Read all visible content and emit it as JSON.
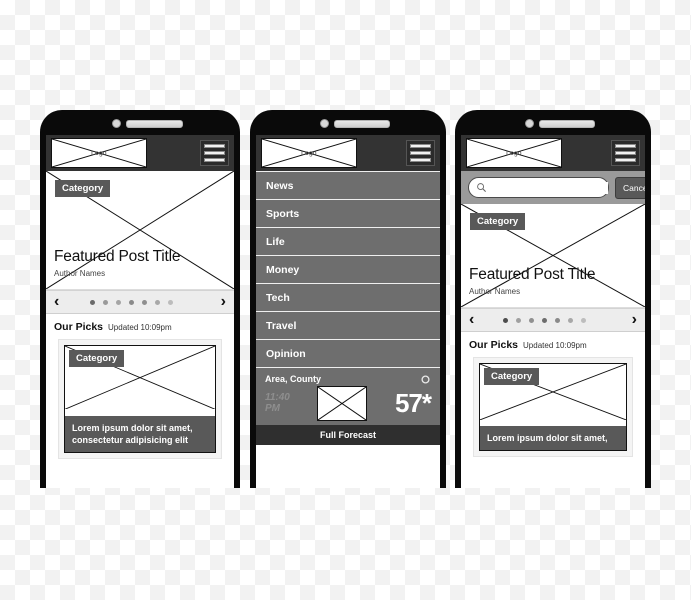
{
  "brand": {
    "logo_label": "Logo",
    "menu_icon": "hamburger-icon",
    "accent_dark": "#333333",
    "accent_gray": "#595959",
    "nav_bg": "#6e6e6e"
  },
  "phones": {
    "home": {
      "name": "home-screen",
      "hero": {
        "category_chip": "Category",
        "title": "Featured Post Title",
        "author": "Author Names"
      },
      "carousel": {
        "prev_label": "‹",
        "next_label": "›",
        "dot_count": 7,
        "dot_colors": [
          "#6b6b6b",
          "#9a9a9a",
          "#a5a5a5",
          "#8a8a8a",
          "#8f8f8f",
          "#a8a8a8",
          "#bcbcbc"
        ]
      },
      "picks": {
        "heading": "Our Picks",
        "updated": "Updated 10:09pm",
        "card": {
          "category_chip": "Category",
          "caption": "Lorem ipsum dolor sit amet, consectetur adipisicing elit"
        }
      }
    },
    "menu": {
      "name": "menu-screen",
      "items": [
        {
          "label": "News"
        },
        {
          "label": "Sports"
        },
        {
          "label": "Life"
        },
        {
          "label": "Money"
        },
        {
          "label": "Tech"
        },
        {
          "label": "Travel"
        },
        {
          "label": "Opinion"
        }
      ],
      "weather": {
        "location": "Area, County",
        "settings_icon": "gear-icon",
        "time": "11:40 PM",
        "time_line1": "11:40",
        "time_line2": "PM",
        "condition_icon": "weather-image-placeholder",
        "temperature": "57*",
        "forecast_label": "Full Forecast"
      }
    },
    "search": {
      "name": "search-screen",
      "search": {
        "icon": "search-icon",
        "value": "",
        "placeholder": "",
        "cancel_label": "Cancel"
      },
      "hero": {
        "category_chip": "Category",
        "title": "Featured Post Title",
        "author": "Author Names"
      },
      "carousel": {
        "prev_label": "‹",
        "next_label": "›",
        "dot_count": 7,
        "dot_colors": [
          "#4d4d4d",
          "#a0a0a0",
          "#909090",
          "#6d6d6d",
          "#8a8a8a",
          "#a8a8a8",
          "#bdbdbd"
        ]
      },
      "picks": {
        "heading": "Our Picks",
        "updated": "Updated 10:09pm",
        "card": {
          "category_chip": "Category",
          "caption": "Lorem ipsum dolor sit amet,"
        }
      }
    }
  }
}
